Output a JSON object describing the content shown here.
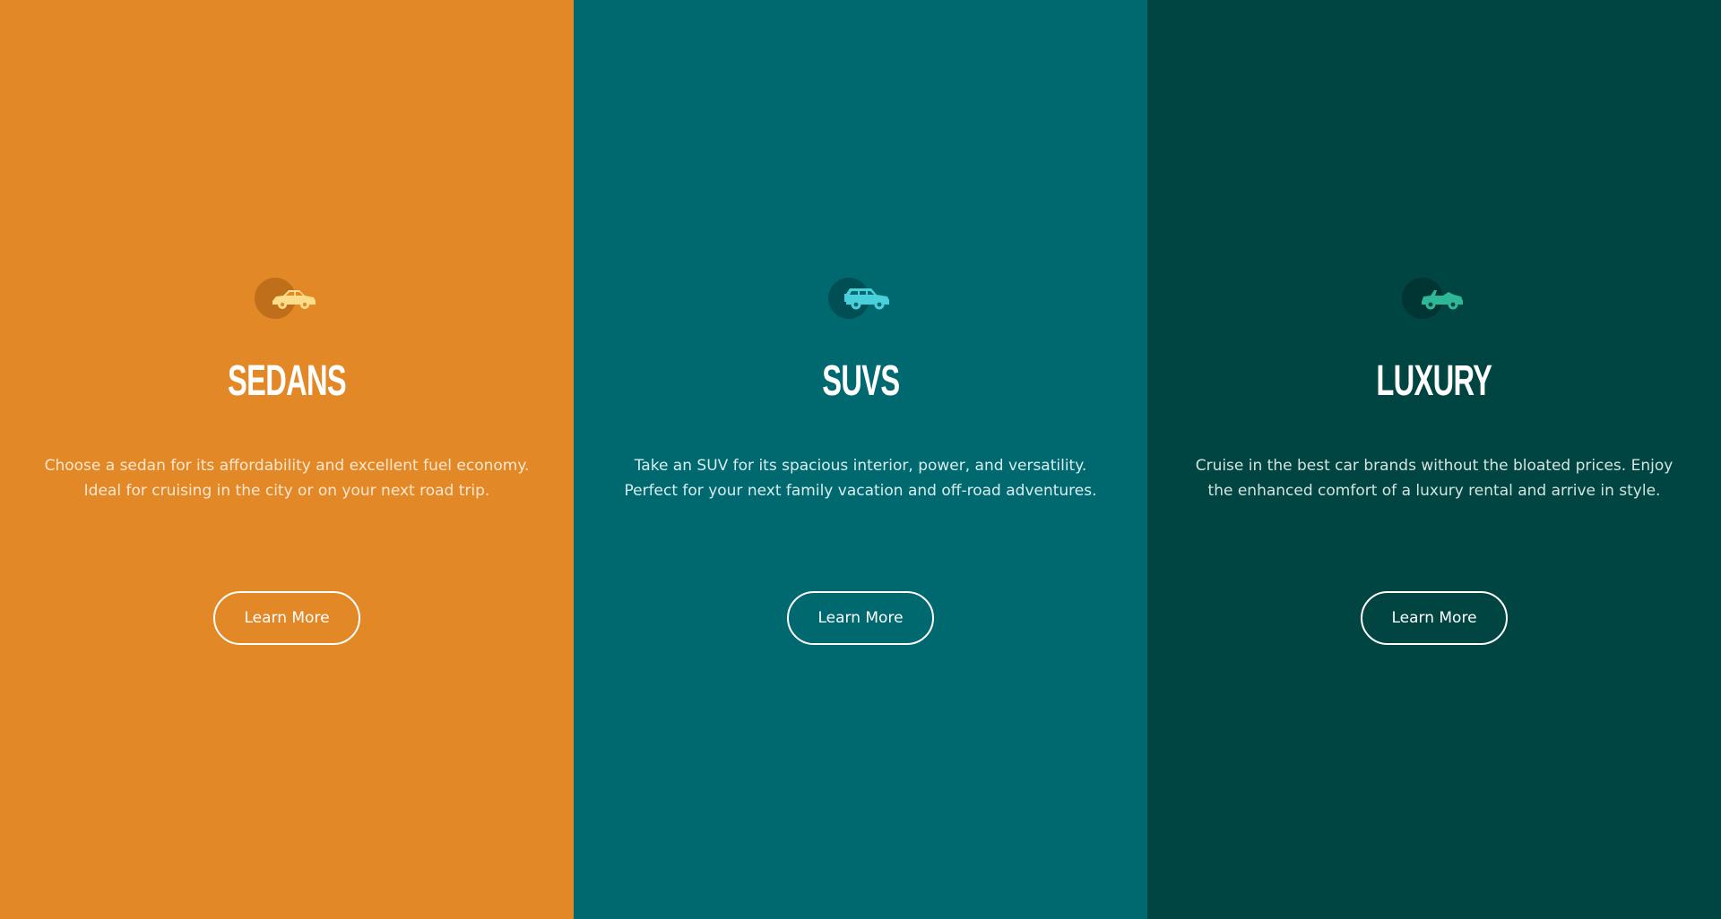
{
  "panels": [
    {
      "title": "SEDANS",
      "text_line_1": "Choose a sedan for its affordability and excellent fuel economy.",
      "text_line_2": "Ideal for cruising in the city or on your next road trip.",
      "button_label": "Learn More",
      "icon": "sedan-icon",
      "bg_color": "#e38826",
      "circle_color": "#bf6e1a",
      "icon_color": "#fbdd8a",
      "text_color": "#fbe7d0"
    },
    {
      "title": "SUVS",
      "text_line_1": "Take an SUV for its spacious interior, power, and versatility.",
      "text_line_2": "Perfect for your next family vacation and off-road adventures.",
      "button_label": "Learn More",
      "icon": "suv-icon",
      "bg_color": "#006970",
      "circle_color": "#004f55",
      "icon_color": "#4ad0da",
      "text_color": "#d8ecec"
    },
    {
      "title": "LUXURY",
      "text_line_1": "Cruise in the best car brands without the bloated prices. Enjoy",
      "text_line_2": "the enhanced comfort of a luxury rental and arrive in style.",
      "button_label": "Learn More",
      "icon": "convertible-icon",
      "bg_color": "#004541",
      "circle_color": "#003533",
      "icon_color": "#2fb897",
      "text_color": "#d4e3df"
    }
  ]
}
